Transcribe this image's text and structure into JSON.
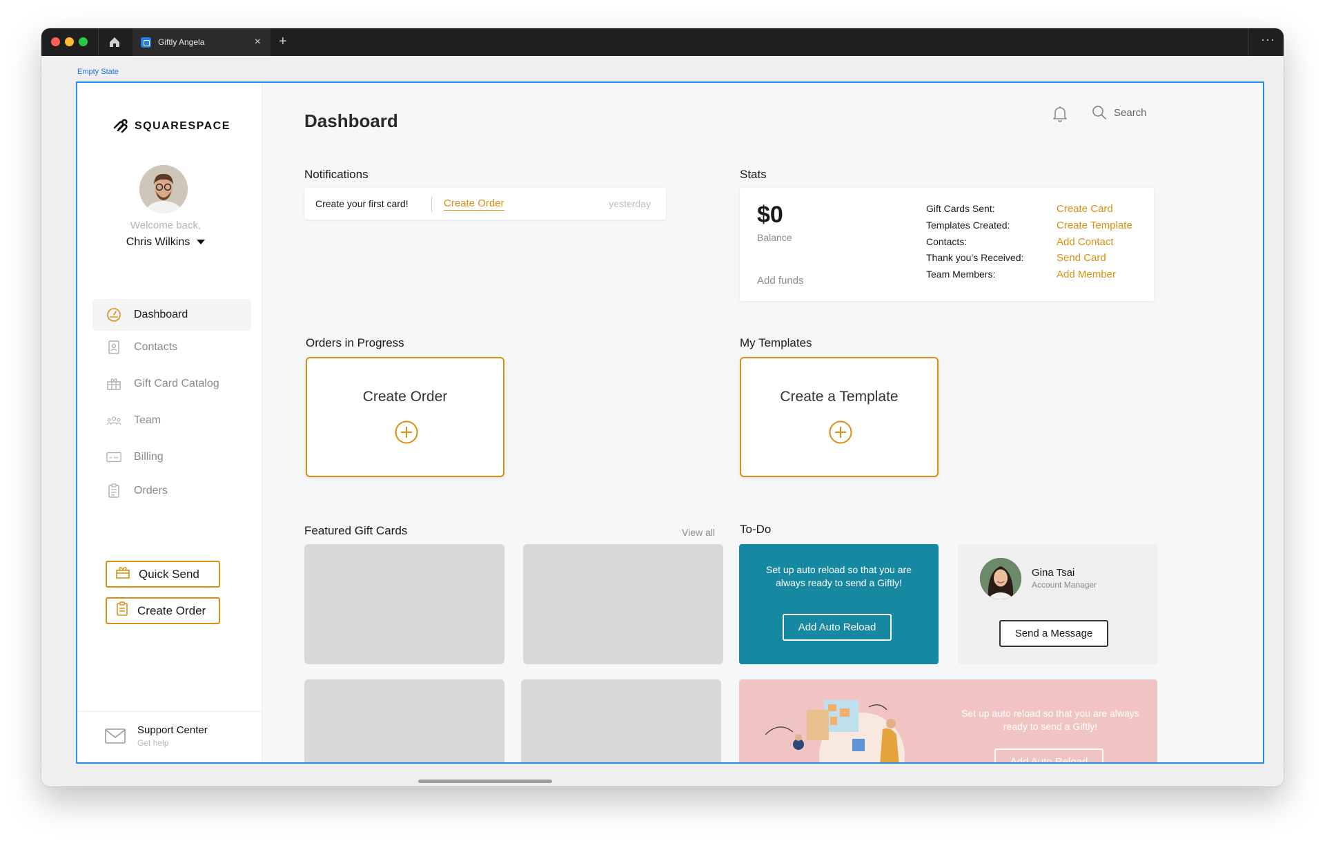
{
  "browser": {
    "tab_title": "Giftly Angela",
    "tab_close": "×",
    "new_tab": "+",
    "more": "···"
  },
  "frame_label": "Empty State",
  "sidebar": {
    "brand": "SQUARESPACE",
    "welcome": "Welcome back,",
    "user_name": "Chris Wilkins",
    "nav": [
      {
        "label": "Dashboard",
        "icon": "gauge-icon",
        "active": true
      },
      {
        "label": "Contacts",
        "icon": "contact-book-icon",
        "active": false
      },
      {
        "label": "Gift Card Catalog",
        "icon": "gift-icon",
        "active": false
      },
      {
        "label": "Team",
        "icon": "team-icon",
        "active": false
      },
      {
        "label": "Billing",
        "icon": "billing-card-icon",
        "active": false
      },
      {
        "label": "Orders",
        "icon": "clipboard-icon",
        "active": false
      }
    ],
    "quick_send": "Quick Send",
    "create_order": "Create Order",
    "support_title": "Support Center",
    "support_sub": "Get help"
  },
  "header": {
    "title": "Dashboard",
    "search_label": "Search"
  },
  "notifications": {
    "title": "Notifications",
    "text": "Create your first card!",
    "link": "Create Order",
    "time": "yesterday"
  },
  "stats": {
    "title": "Stats",
    "balance": "$0",
    "balance_label": "Balance",
    "add_funds": "Add funds",
    "rows": [
      {
        "label": "Gift Cards Sent:",
        "action": "Create Card"
      },
      {
        "label": "Templates Created:",
        "action": "Create Template"
      },
      {
        "label": "Contacts:",
        "action": "Add Contact"
      },
      {
        "label": "Thank you’s Received:",
        "action": "Send Card"
      },
      {
        "label": "Team Members:",
        "action": "Add Member"
      }
    ]
  },
  "orders": {
    "title": "Orders in Progress",
    "card_label": "Create Order"
  },
  "templates": {
    "title": "My Templates",
    "card_label": "Create a Template"
  },
  "featured": {
    "title": "Featured Gift Cards",
    "view_all": "View all"
  },
  "todo": {
    "title": "To-Do",
    "teal_text": "Set up auto reload so that you are always ready to send a Giftly!",
    "teal_button": "Add Auto Reload",
    "contact_name": "Gina Tsai",
    "contact_role": "Account Manager",
    "contact_button": "Send a Message",
    "pink_text": "Set up auto reload so that you are always ready to send a Giftly!",
    "pink_button": "Add Auto Reload"
  },
  "colors": {
    "accent": "#d98f0f",
    "teal": "#1788a1",
    "pink": "#f1c4c4",
    "frame": "#2b8cf0"
  }
}
